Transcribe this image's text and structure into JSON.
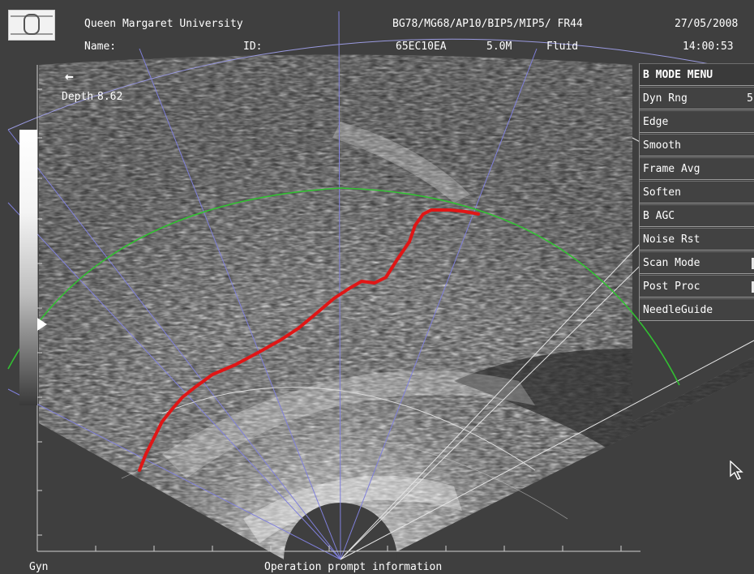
{
  "header": {
    "institution": "Queen Margaret University",
    "settings": "BG78/MG68/AP10/BIP5/MIP5/ FR44",
    "date": "27/05/2008",
    "name_label": "Name:",
    "id_label": "ID:",
    "probe": "65EC10EA",
    "frequency": "5.0M",
    "preset": "Fluid",
    "time": "14:00:53"
  },
  "scan_info": {
    "depth_label": "Depth",
    "depth_value": "8.62",
    "back_arrow_icon": "arrow-left-icon"
  },
  "menu": {
    "title": "B MODE MENU",
    "items": [
      {
        "label": "Dyn Rng",
        "value": "5"
      },
      {
        "label": "Edge",
        "value": ""
      },
      {
        "label": "Smooth",
        "value": ""
      },
      {
        "label": "Frame Avg",
        "value": ""
      },
      {
        "label": "Soften",
        "value": ""
      },
      {
        "label": "B AGC",
        "value": ""
      },
      {
        "label": "Noise Rst",
        "value": ""
      },
      {
        "label": "Scan Mode",
        "value": ""
      },
      {
        "label": "Post Proc",
        "value": ""
      },
      {
        "label": "NeedleGuide",
        "value": ""
      }
    ]
  },
  "footer": {
    "gain_label": "Gyn",
    "prompt": "Operation prompt information"
  },
  "colors": {
    "background": "#3f3f3f",
    "guide_lines": "#7f7fd8",
    "trace": "#e01616",
    "arc": "#2fbf2f",
    "text": "#ffffff"
  },
  "icons": {
    "cursor": "mouse-pointer-icon",
    "logo": "university-logo-icon"
  }
}
